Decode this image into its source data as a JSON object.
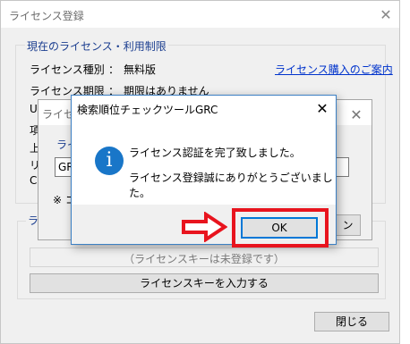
{
  "main_window": {
    "title": "ライセンス登録",
    "group_title": "現在のライセンス・利用制限",
    "license_type_label": "ライセンス種別",
    "license_type_colon": "：",
    "license_type_value": "無料版",
    "purchase_link": "ライセンス購入のご案内",
    "license_period_label": "ライセンス期限",
    "license_period_colon": "：",
    "license_period_value": "期限はありません",
    "partial_url_label": "UR",
    "partial_row_4": "項",
    "partial_row_5": "上",
    "partial_row_6": "リ",
    "partial_row_7": "C",
    "partial_note": "※ ",
    "license_section_partial": "ライ",
    "license_key_status": "（ライセンスキーは未登録です）",
    "enter_key_button": "ライセンスキーを入力する",
    "close_button": "閉じる"
  },
  "middle_window": {
    "title_partial": "ライセ",
    "group_partial": "ライ",
    "input_partial": "GR",
    "note_partial": "※ コ",
    "button_partial": "ン"
  },
  "message_box": {
    "title": "検索順位チェックツールGRC",
    "icon": "info-icon",
    "line1": "ライセンス認証を完了致しました。",
    "line2": "ライセンス登録誠にありがとうございました。",
    "ok_button": "OK"
  },
  "annotation": {
    "arrow": "arrow-right-icon",
    "highlight_color": "#e8141e"
  },
  "colors": {
    "link": "#0033cc",
    "accent_blue": "#1976c8",
    "dialog_border": "#3c80c4",
    "heading_blue": "#1a3d8f"
  }
}
